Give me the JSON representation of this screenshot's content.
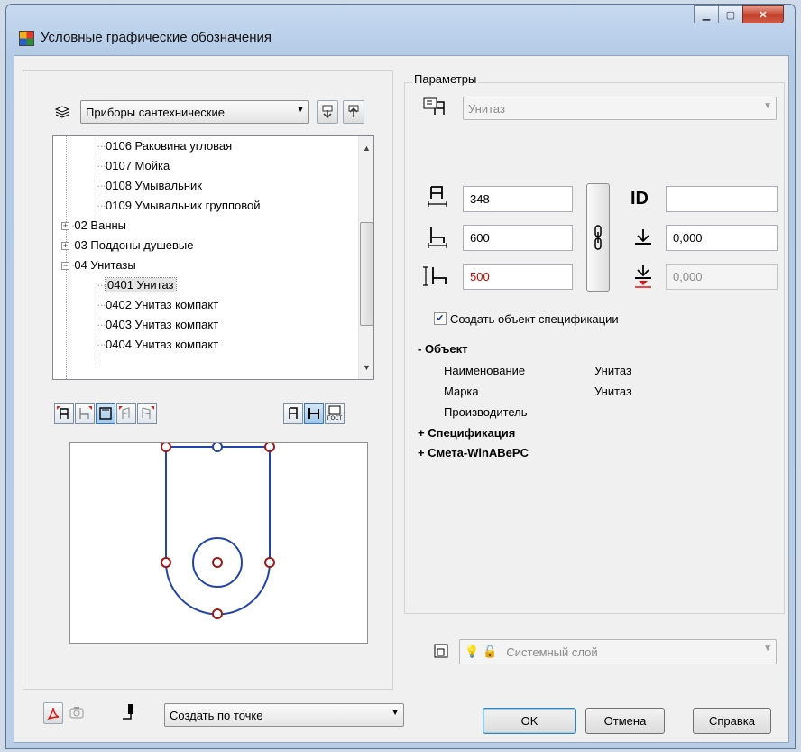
{
  "window": {
    "title": "Условные графические обозначения"
  },
  "left": {
    "category_combo": "Приборы сантехнические",
    "tree_items": [
      "0106 Раковина угловая",
      "0107 Мойка",
      "0108 Умывальник",
      "0109 Умывальник групповой",
      "02 Ванны",
      "03 Поддоны душевые",
      "04 Унитазы",
      "0401 Унитаз",
      "0402 Унитаз компакт",
      "0403 Унитаз компакт",
      "0404 Унитаз компакт"
    ],
    "tree_selected": "0401 Унитаз",
    "creation_mode": "Создать по точке"
  },
  "params": {
    "group_label": "Параметры",
    "type_combo": "Унитаз",
    "width": "348",
    "depth": "600",
    "height": "500",
    "id_label": "ID",
    "id_value": "",
    "elevation": "0,000",
    "elevation2": "0,000",
    "create_spec_label": "Создать объект спецификации",
    "create_spec_checked": true,
    "object_section": "- Объект",
    "props": [
      {
        "name": "Наименование",
        "value": "Унитаз"
      },
      {
        "name": "Марка",
        "value": "Унитаз"
      },
      {
        "name": "Производитель",
        "value": ""
      }
    ],
    "spec_section": "+ Спецификация",
    "smeta_section": "+ Смета-WinABePC",
    "layer_combo": "Системный слой"
  },
  "buttons": {
    "ok": "OK",
    "cancel": "Отмена",
    "help": "Справка"
  },
  "colors": {
    "drawing": "#2244a8",
    "grip": "#a01818",
    "accent": "#3b79b5"
  }
}
